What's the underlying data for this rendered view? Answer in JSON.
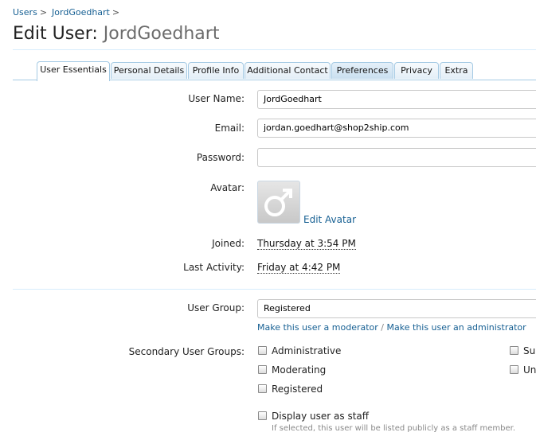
{
  "breadcrumb": {
    "items": [
      "Users",
      "JordGoedhart"
    ],
    "separator": ">"
  },
  "title": {
    "prefix": "Edit User:",
    "username": "JordGoedhart"
  },
  "tabs": [
    {
      "label": "User Essentials",
      "state": "active"
    },
    {
      "label": "Personal Details",
      "state": "normal"
    },
    {
      "label": "Profile Info",
      "state": "normal"
    },
    {
      "label": "Additional Contact",
      "state": "normal"
    },
    {
      "label": "Preferences",
      "state": "highlighted"
    },
    {
      "label": "Privacy",
      "state": "normal"
    },
    {
      "label": "Extra",
      "state": "normal"
    }
  ],
  "form": {
    "username": {
      "label": "User Name:",
      "value": "JordGoedhart"
    },
    "email": {
      "label": "Email:",
      "value": "jordan.goedhart@shop2ship.com"
    },
    "password": {
      "label": "Password:",
      "value": ""
    },
    "avatar": {
      "label": "Avatar:",
      "icon": "male-symbol-icon",
      "edit_link": "Edit Avatar"
    },
    "joined": {
      "label": "Joined:",
      "value": "Thursday at 3:54 PM"
    },
    "last_activity": {
      "label": "Last Activity:",
      "value": "Friday at 4:42 PM"
    },
    "user_group": {
      "label": "User Group:",
      "value": "Registered",
      "make_moderator": "Make this user a moderator",
      "divider": "/",
      "make_admin": "Make this user an administrator"
    },
    "secondary_groups": {
      "label": "Secondary User Groups:",
      "options": [
        {
          "label": "Administrative",
          "checked": false
        },
        {
          "label": "Moderating",
          "checked": false
        },
        {
          "label": "Registered",
          "checked": false
        },
        {
          "label": "Sup",
          "checked": false
        },
        {
          "label": "Un",
          "checked": false
        }
      ]
    },
    "display_staff": {
      "label": "Display user as staff",
      "checked": false,
      "hint": "If selected, this user will be listed publicly as a staff member."
    }
  },
  "colors": {
    "link": "#176093",
    "tab_border": "#a5cae4",
    "divider": "#d7edfc"
  }
}
